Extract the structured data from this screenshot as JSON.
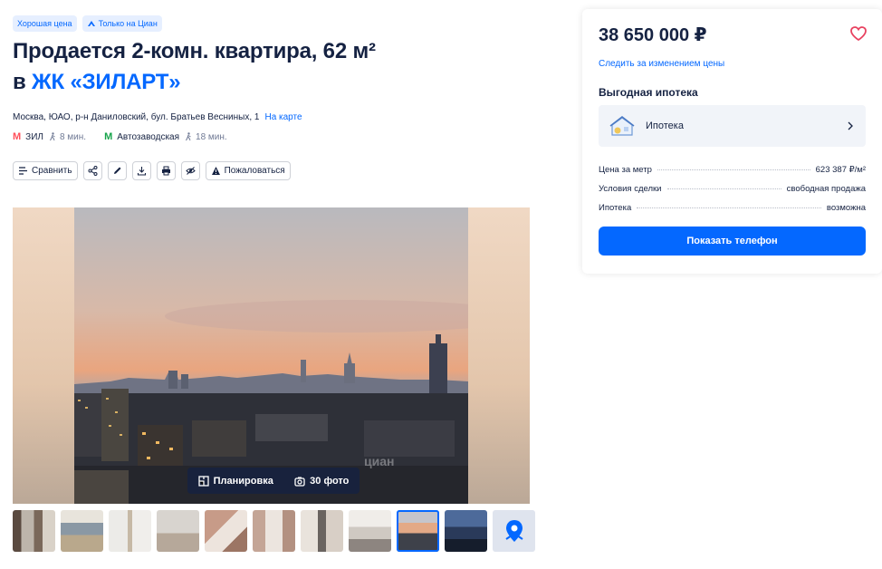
{
  "badges": [
    {
      "label": "Хорошая цена"
    },
    {
      "label": "Только на Циан"
    }
  ],
  "title": {
    "line1": "Продается 2-комн. квартира, 62 м²",
    "line2_prefix": "в ",
    "line2_link": "ЖК «ЗИЛАРТ»"
  },
  "address": {
    "text": "Москва, ЮАО, р-н Даниловский, бул. Братьев Весниных, 1",
    "map_link": "На карте"
  },
  "metro": [
    {
      "icon": "М",
      "color": "#ff4f5a",
      "station": "ЗИЛ",
      "walk": "8 мин."
    },
    {
      "icon": "М",
      "color": "#16a34a",
      "station": "Автозаводская",
      "walk": "18 мин."
    }
  ],
  "toolbar": {
    "compare": "Сравнить",
    "complain": "Пожаловаться",
    "icons": [
      "share-icon",
      "edit-icon",
      "download-icon",
      "print-icon",
      "hide-icon"
    ]
  },
  "gallery": {
    "layout_label": "Планировка",
    "photos_label": "30 фото",
    "thumb_count": 11,
    "active_thumb": 9
  },
  "card": {
    "price": "38 650 000 ₽",
    "follow_link": "Следить за изменением цены",
    "mortgage_title": "Выгодная ипотека",
    "mortgage_label": "Ипотека",
    "facts": [
      {
        "label": "Цена за метр",
        "value": "623 387 ₽/м²"
      },
      {
        "label": "Условия сделки",
        "value": "свободная продажа"
      },
      {
        "label": "Ипотека",
        "value": "возможна"
      }
    ],
    "phone_button": "Показать телефон"
  },
  "colors": {
    "accent": "#0468ff",
    "text": "#152242",
    "favorite": "#e84260"
  }
}
